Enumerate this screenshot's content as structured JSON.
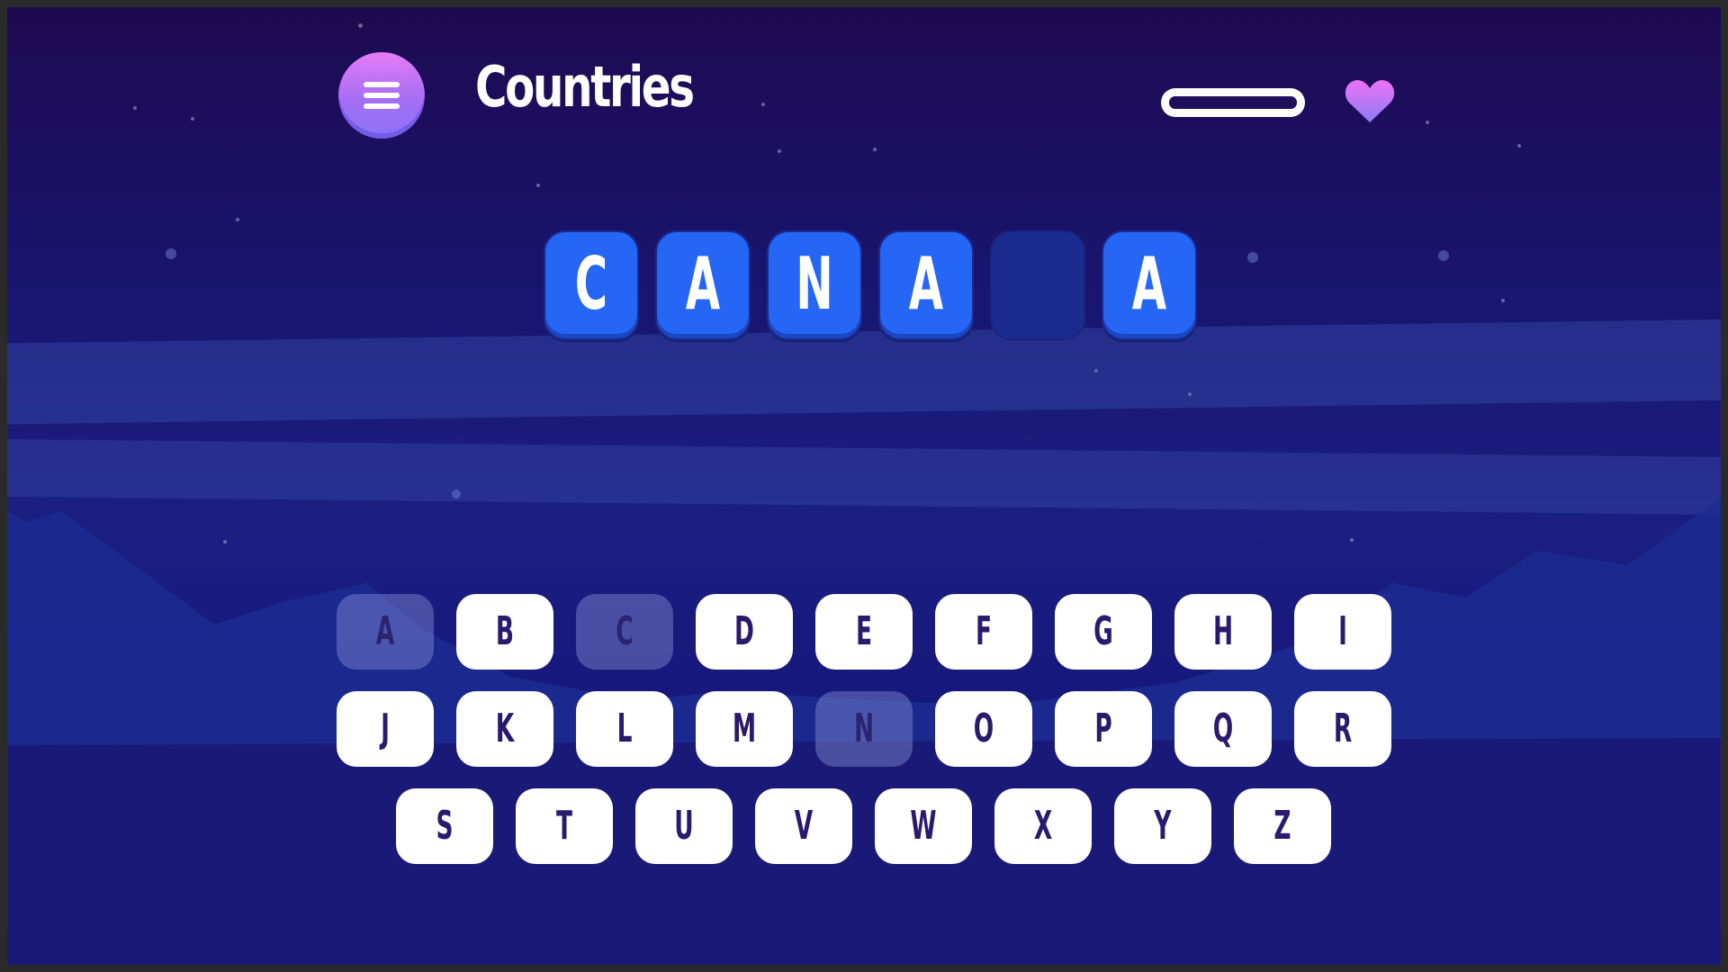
{
  "header": {
    "category": "Countries",
    "menu_icon": "hamburger-menu-icon",
    "lives_icon": "heart-icon",
    "lives_progress": 1.0
  },
  "word": {
    "letters": [
      "C",
      "A",
      "N",
      "A",
      "",
      "A"
    ]
  },
  "keyboard": {
    "rows": [
      [
        "A",
        "B",
        "C",
        "D",
        "E",
        "F",
        "G",
        "H",
        "I"
      ],
      [
        "J",
        "K",
        "L",
        "M",
        "N",
        "O",
        "P",
        "Q",
        "R"
      ],
      [
        "S",
        "T",
        "U",
        "V",
        "W",
        "X",
        "Y",
        "Z"
      ]
    ],
    "used": [
      "A",
      "C",
      "N"
    ]
  },
  "colors": {
    "tile_filled": "#2666f5",
    "tile_empty": "#1c2b8e",
    "key_bg": "#ffffff",
    "key_text": "#2a1a6e",
    "menu_gradient_top": "#e67bf6",
    "menu_gradient_bottom": "#8b74f7"
  }
}
